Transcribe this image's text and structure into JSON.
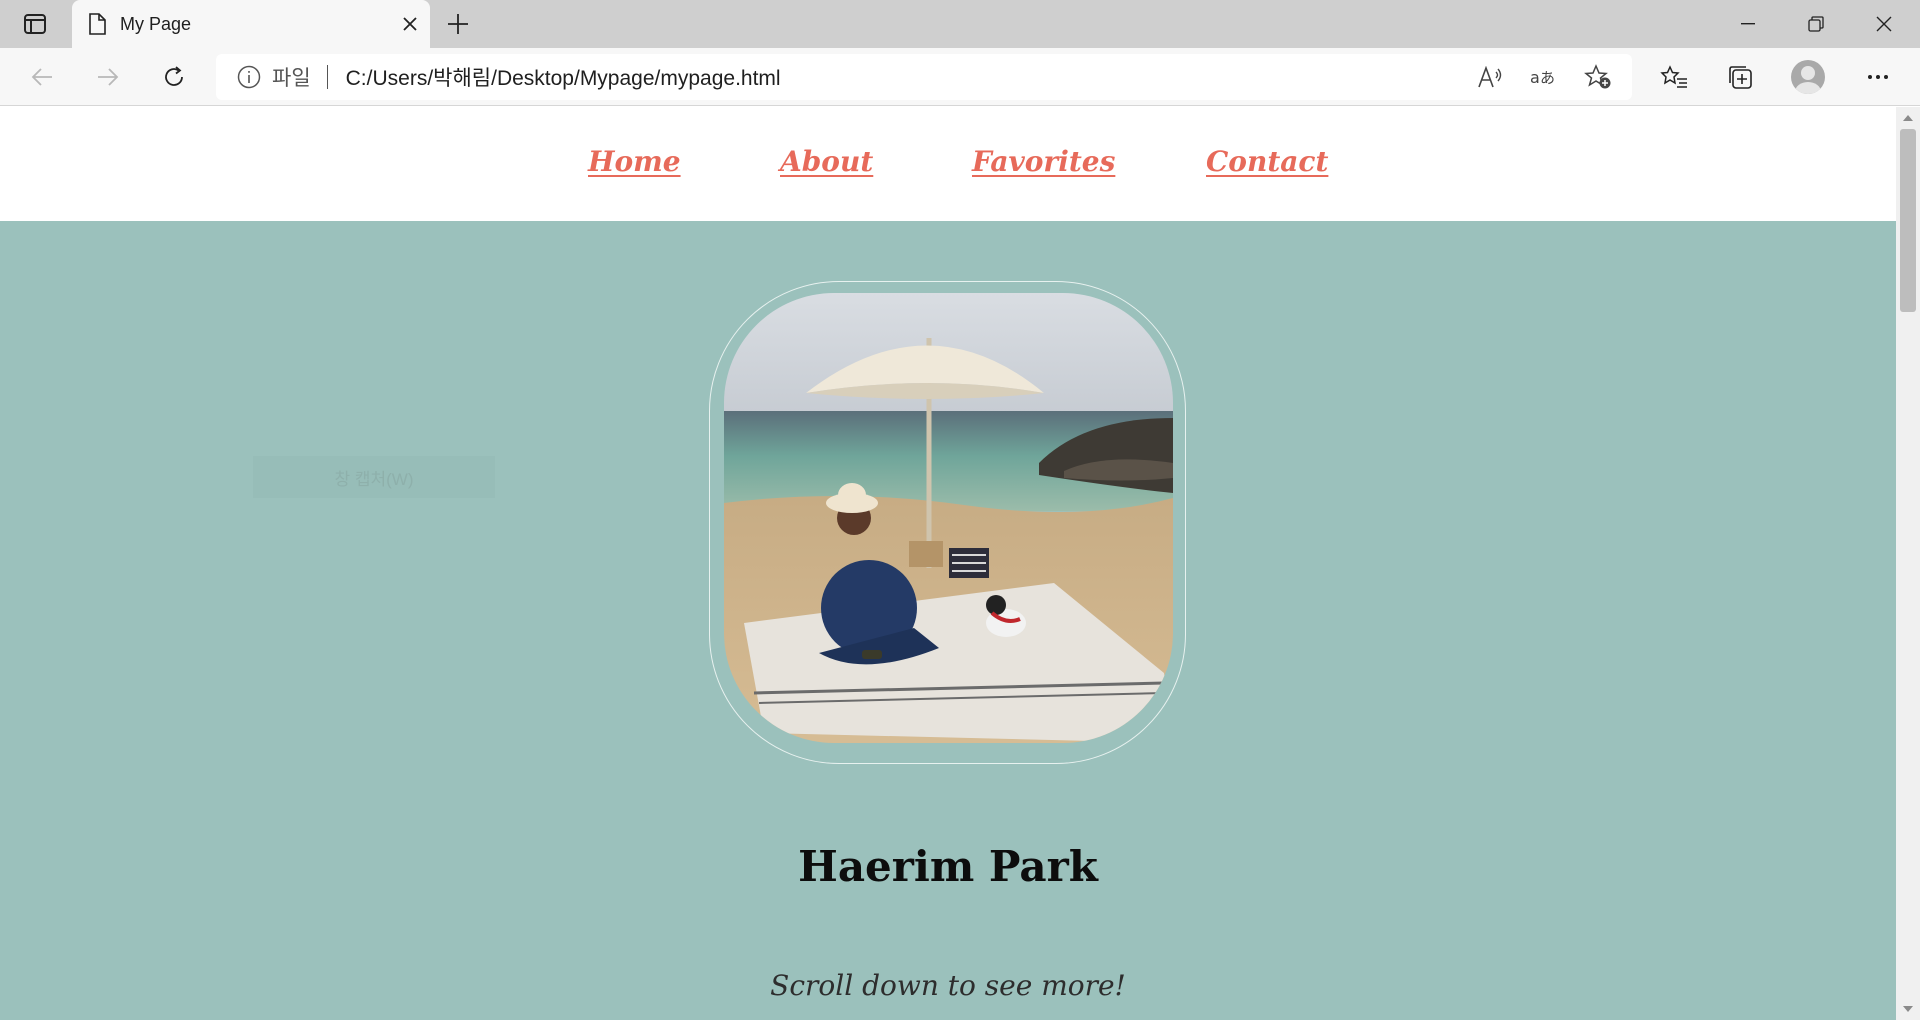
{
  "browser": {
    "tab": {
      "title": "My Page"
    },
    "address": {
      "scheme_label": "파일",
      "url": "C:/Users/박해림/Desktop/Mypage/mypage.html"
    }
  },
  "site": {
    "nav": [
      {
        "label": "Home"
      },
      {
        "label": "About"
      },
      {
        "label": "Favorites"
      },
      {
        "label": "Contact"
      }
    ],
    "overlay_text": "창 캡처(W)",
    "name": "Haerim Park",
    "scroll_hint": "Scroll down to see more!",
    "accent_color": "#e76a5a",
    "background_color": "#9bc1bc"
  }
}
